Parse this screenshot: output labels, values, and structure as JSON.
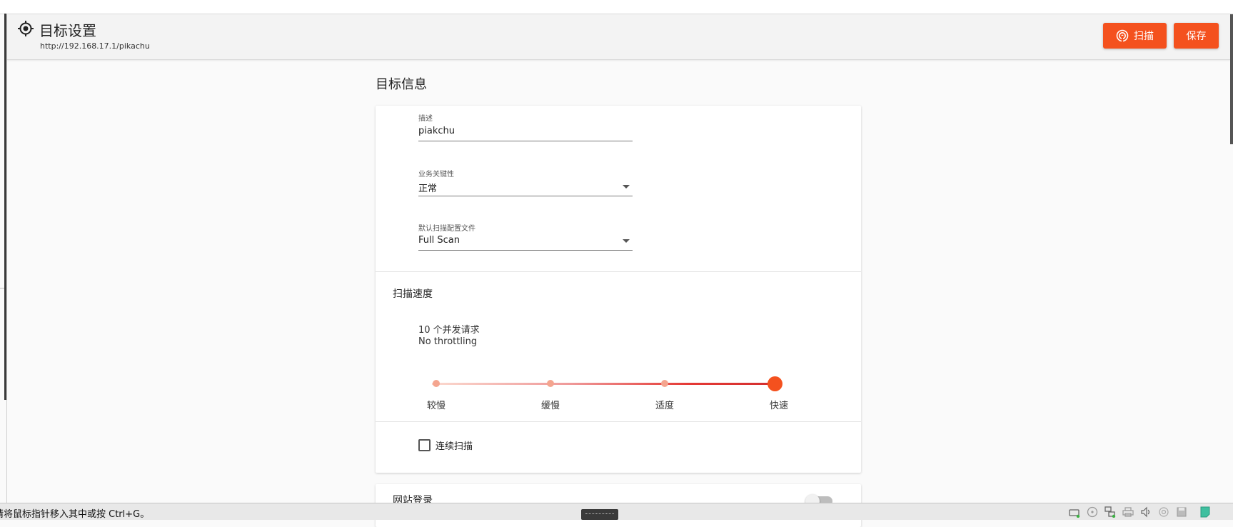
{
  "header": {
    "title": "目标设置",
    "url": "http://192.168.17.1/pikachu",
    "scan_label": "扫描",
    "save_label": "保存"
  },
  "section": {
    "title": "目标信息"
  },
  "form": {
    "description": {
      "label": "描述",
      "value": "piakchu"
    },
    "criticality": {
      "label": "业务关键性",
      "value": "正常"
    },
    "profile": {
      "label": "默认扫描配置文件",
      "value": "Full Scan"
    }
  },
  "speed": {
    "title": "扫描速度",
    "line1": "10 个并发请求",
    "line2": "No throttling",
    "stops": [
      "较慢",
      "缓慢",
      "适度",
      "快速"
    ],
    "selected": "快速"
  },
  "continuous": {
    "label": "连续扫描",
    "checked": false
  },
  "login": {
    "title": "网站登录",
    "enabled": false
  },
  "statusbar": {
    "text": "请将鼠标指针移入其中或按 Ctrl+G。",
    "tray_icons": [
      "hard-disk-icon",
      "optical-drive-icon",
      "network-icon",
      "printer-icon",
      "audio-icon",
      "usb-icon",
      "floppy-icon",
      "note-icon"
    ]
  },
  "colors": {
    "accent": "#f4511e",
    "slider_stop": "#f4a58f",
    "slider_track_end": "#d32f2f"
  }
}
